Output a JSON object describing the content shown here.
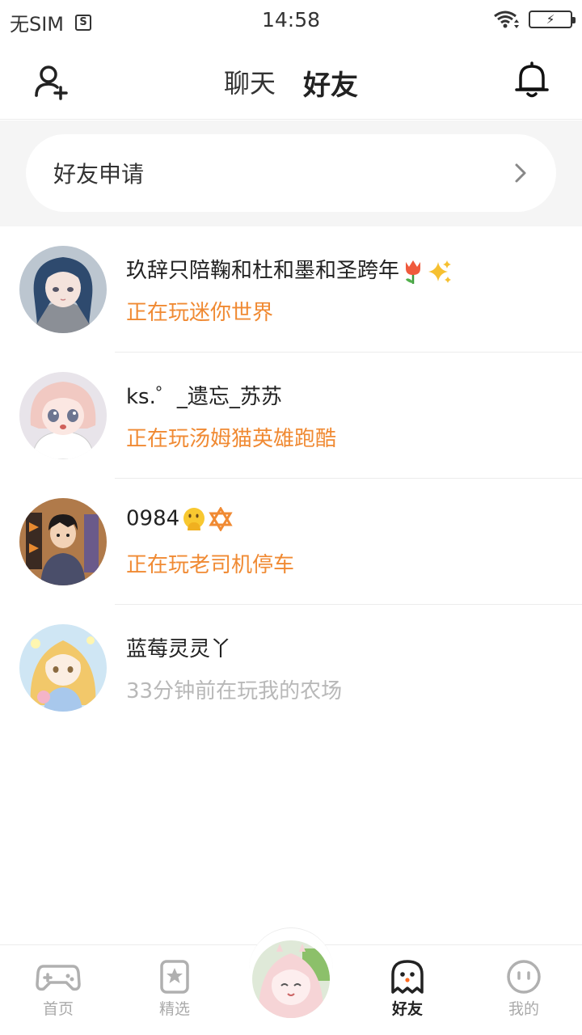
{
  "status_bar": {
    "carrier": "无SIM",
    "time": "14:58"
  },
  "header": {
    "tabs": [
      {
        "label": "聊天",
        "active": false
      },
      {
        "label": "好友",
        "active": true
      }
    ]
  },
  "friend_request": {
    "label": "好友申请"
  },
  "friends": [
    {
      "name": "玖辞只陪鞠和杜和墨和圣跨年",
      "name_emojis": [
        "tulip",
        "sparkles"
      ],
      "status": "正在玩迷你世界",
      "status_color": "#f08a33"
    },
    {
      "name": "ks.゜_遗忘_苏苏",
      "name_emojis": [],
      "status": "正在玩汤姆猫英雄跑酷",
      "status_color": "#f08a33"
    },
    {
      "name": "0984",
      "name_emojis": [
        "face-with-hand-over-mouth",
        "star-of-david"
      ],
      "status": "正在玩老司机停车",
      "status_color": "#f08a33"
    },
    {
      "name": "蓝莓灵灵丫",
      "name_emojis": [],
      "status": "33分钟前在玩我的农场",
      "status_color": "#b8b8b8"
    }
  ],
  "bottom_nav": {
    "items": [
      {
        "label": "首页",
        "icon": "gamepad-icon",
        "active": false
      },
      {
        "label": "精选",
        "icon": "star-bookmark-icon",
        "active": false
      },
      {
        "label": "好友",
        "icon": "ghost-icon",
        "active": true
      },
      {
        "label": "我的",
        "icon": "smiley-face-icon",
        "active": false
      }
    ]
  },
  "colors": {
    "accent": "#ff5a1f",
    "playing": "#f08a33",
    "offline": "#b8b8b8"
  }
}
